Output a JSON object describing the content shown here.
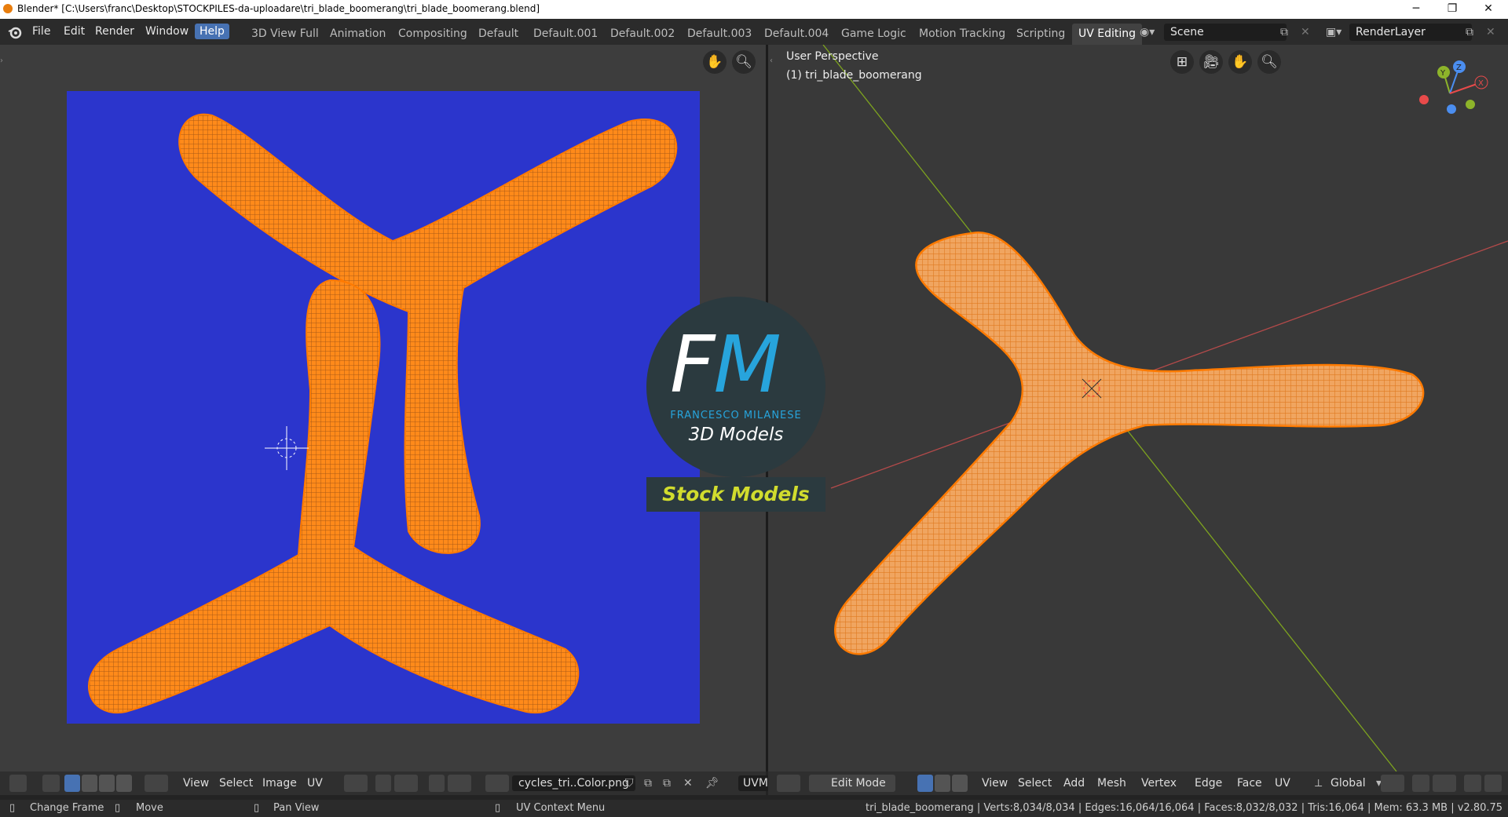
{
  "window": {
    "title": "Blender* [C:\\Users\\franc\\Desktop\\STOCKPILES-da-uploadare\\tri_blade_boomerang\\tri_blade_boomerang.blend]",
    "minimize": "─",
    "restore": "❐",
    "close": "✕"
  },
  "menu": {
    "items": [
      "File",
      "Edit",
      "Render",
      "Window",
      "Help"
    ]
  },
  "workspaces": {
    "tabs": [
      "3D View Full",
      "Animation",
      "Compositing",
      "Default",
      "Default.001",
      "Default.002",
      "Default.003",
      "Default.004",
      "Game Logic",
      "Motion Tracking",
      "Scripting",
      "UV Editing"
    ],
    "active": "UV Editing"
  },
  "scene": {
    "name": "Scene"
  },
  "render_layer": {
    "name": "RenderLayer"
  },
  "uv_editor": {
    "header": {
      "view": "View",
      "select": "Select",
      "image": "Image",
      "uv": "UV",
      "image_name": "cycles_tri..Color.png",
      "uvmap": "UVM"
    },
    "image_bg": "#2b35cc",
    "mesh_color": "#ff8a1a"
  },
  "viewport": {
    "perspective": "User Perspective",
    "object_label": "(1) tri_blade_boomerang",
    "header": {
      "mode": "Edit Mode",
      "view": "View",
      "select": "Select",
      "add": "Add",
      "mesh": "Mesh",
      "vertex": "Vertex",
      "edge": "Edge",
      "face": "Face",
      "uv": "UV",
      "orientation": "Global"
    },
    "gizmo": {
      "x": "X",
      "y": "Y",
      "z": "Z"
    }
  },
  "logo": {
    "f": "F",
    "m": "M",
    "name": "FRANCESCO MILANESE",
    "subtitle": "3D Models",
    "banner": "Stock Models"
  },
  "status": {
    "change_frame": "Change Frame",
    "move": "Move",
    "pan_view": "Pan View",
    "uv_context_menu": "UV Context Menu",
    "stats": "tri_blade_boomerang | Verts:8,034/8,034 | Edges:16,064/16,064 | Faces:8,032/8,032 | Tris:16,064 | Mem: 63.3 MB | v2.80.75"
  },
  "colors": {
    "accent": "#4772b3",
    "orange": "#ff8a1a",
    "uv_blue": "#2b35cc"
  }
}
